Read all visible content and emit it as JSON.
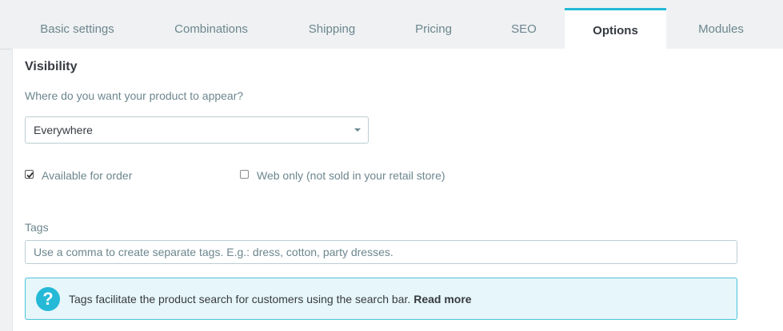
{
  "tabs": [
    {
      "label": "Basic settings",
      "active": false
    },
    {
      "label": "Combinations",
      "active": false
    },
    {
      "label": "Shipping",
      "active": false
    },
    {
      "label": "Pricing",
      "active": false
    },
    {
      "label": "SEO",
      "active": false
    },
    {
      "label": "Options",
      "active": true
    },
    {
      "label": "Modules",
      "active": false
    }
  ],
  "visibility": {
    "title": "Visibility",
    "question": "Where do you want your product to appear?",
    "selected": "Everywhere"
  },
  "checkboxes": {
    "available_for_order": {
      "label": "Available for order",
      "checked": true
    },
    "web_only": {
      "label": "Web only (not sold in your retail store)",
      "checked": false
    }
  },
  "tags": {
    "label": "Tags",
    "placeholder": "Use a comma to create separate tags. E.g.: dress, cotton, party dresses.",
    "value": ""
  },
  "info": {
    "text": "Tags facilitate the product search for customers using the search bar.",
    "link": "Read more"
  },
  "colors": {
    "accent": "#25b9d7",
    "info_bg": "#e6f6fa",
    "info_border": "#4cc3db"
  }
}
